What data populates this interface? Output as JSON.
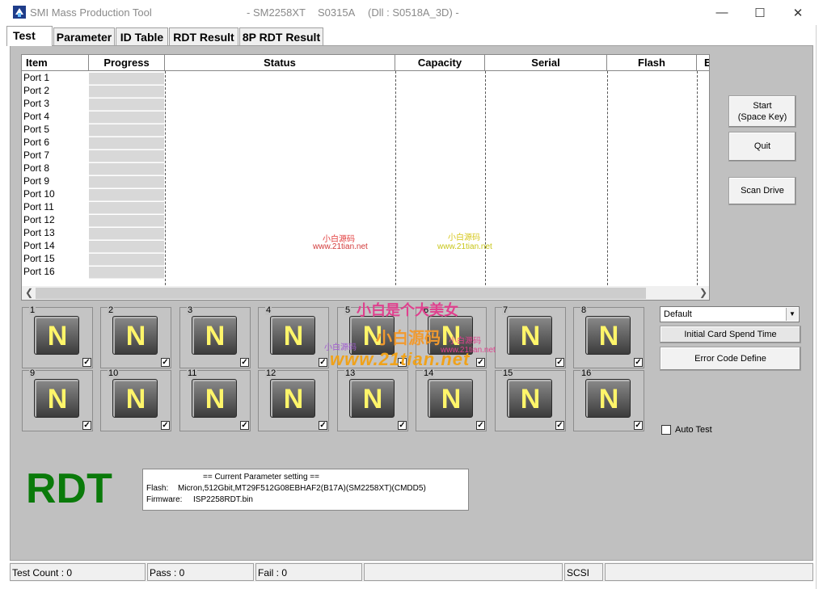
{
  "window": {
    "app_title": "SMI Mass Production Tool",
    "chip": "- SM2258XT",
    "firmware_code": "S0315A",
    "dll": "(Dll : S0518A_3D) -",
    "minimize": "—",
    "maximize": "☐",
    "close": "✕"
  },
  "tabs": [
    "Test",
    "Parameter",
    "ID Table",
    "RDT Result",
    "8P RDT Result"
  ],
  "grid": {
    "columns": [
      "Item",
      "Progress",
      "Status",
      "Capacity",
      "Serial",
      "Flash",
      "E"
    ],
    "ports": [
      "Port 1",
      "Port 2",
      "Port 3",
      "Port 4",
      "Port 5",
      "Port 6",
      "Port 7",
      "Port 8",
      "Port 9",
      "Port 10",
      "Port 11",
      "Port 12",
      "Port 13",
      "Port 14",
      "Port 15",
      "Port 16"
    ]
  },
  "buttons": {
    "start_line1": "Start",
    "start_line2": "(Space Key)",
    "quit": "Quit",
    "scan_drive": "Scan Drive",
    "initial_card": "Initial Card Spend Time",
    "error_code": "Error Code Define"
  },
  "preset_select": "Default",
  "auto_test_label": "Auto Test",
  "port_boxes": {
    "numbers": [
      "1",
      "2",
      "3",
      "4",
      "5",
      "6",
      "7",
      "8",
      "9",
      "10",
      "11",
      "12",
      "13",
      "14",
      "15",
      "16"
    ],
    "drive_letter": "N",
    "check_mark": "✓"
  },
  "mode_label": "RDT",
  "params": {
    "title": "== Current Parameter setting ==",
    "flash_label": "Flash:",
    "flash_value": "Micron,512Gbit,MT29F512G08EBHAF2(B17A)(SM2258XT)(CMDD5)",
    "firmware_label": "Firmware:",
    "firmware_value": "ISP2258RDT.bin"
  },
  "statusbar": {
    "test_count": "Test Count : 0",
    "pass": "Pass : 0",
    "fail": "Fail : 0",
    "blank": "",
    "interface": "SCSI"
  },
  "watermarks": {
    "line1": "小白是个大美女",
    "line2": "小白源码",
    "line3": "www.21tian.net",
    "small_a": "小白源码",
    "small_b": "www.21tian.net"
  },
  "colors": {
    "panel": "#c0c0c0",
    "rdt_green": "#0a7a0a",
    "drive_letter": "#fff56a"
  }
}
